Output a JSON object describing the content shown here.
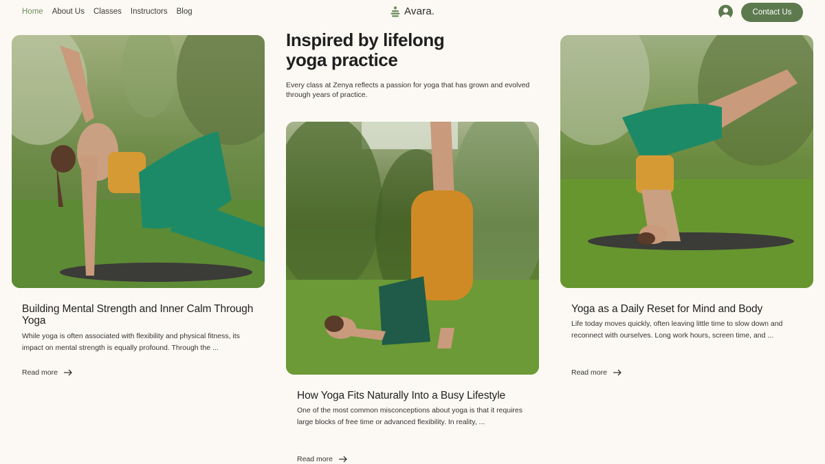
{
  "nav": {
    "items": [
      {
        "label": "Home",
        "active": true
      },
      {
        "label": "About Us",
        "active": false
      },
      {
        "label": "Classes",
        "active": false
      },
      {
        "label": "Instructors",
        "active": false
      },
      {
        "label": "Blog",
        "active": false
      }
    ],
    "brand": "Avara.",
    "contact_label": "Contact Us",
    "user_icon": "user-avatar-icon"
  },
  "hero": {
    "title_line1": "Inspired by lifelong",
    "title_line2": "yoga practice",
    "subtitle": "Every class at Zenya reflects a passion for yoga that has grown and evolved through years of practice."
  },
  "posts": [
    {
      "title": "Building Mental Strength and Inner Calm Through Yoga",
      "excerpt": "While yoga is often associated with flexibility and physical fitness, its impact on mental strength is equally profound. Through the ...",
      "read_more": "Read more"
    },
    {
      "title": "How Yoga Fits Naturally Into a Busy Lifestyle",
      "excerpt": "One of the most common misconceptions about yoga is that it requires large blocks of free time or advanced flexibility. In reality, ...",
      "read_more": "Read more"
    },
    {
      "title": "Yoga as a Daily Reset for Mind and Body",
      "excerpt": "Life today moves quickly, often leaving little time to slow down and reconnect with ourselves. Long work hours, screen time, and ...",
      "read_more": "Read more"
    }
  ],
  "colors": {
    "background": "#fcf9f4",
    "accent": "#5d7a4f",
    "active_nav": "#6e8f5f"
  }
}
